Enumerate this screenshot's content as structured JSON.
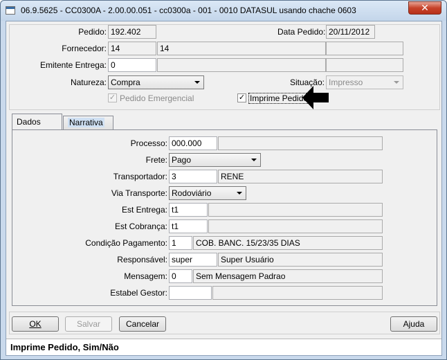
{
  "window": {
    "title": "06.9.5625 - CC0300A - 2.00.00.051 - cc0300a - 001 - 0010 DATASUL usando chache 0603",
    "close_symbol": "✕"
  },
  "header": {
    "pedido_label": "Pedido:",
    "pedido_value": "192.402",
    "data_pedido_label": "Data Pedido:",
    "data_pedido_value": "20/11/2012",
    "fornecedor_label": "Fornecedor:",
    "fornecedor_code": "14",
    "fornecedor_name": "14",
    "emitente_label": "Emitente Entrega:",
    "emitente_value": "0",
    "natureza_label": "Natureza:",
    "natureza_value": "Compra",
    "situacao_label": "Situação:",
    "situacao_value": "Impresso",
    "pedido_emergencial_label": "Pedido Emergencial",
    "imprime_pedido_label": "Imprime Pedido",
    "check_mark": "✓"
  },
  "tabs": [
    {
      "label": "Dados"
    },
    {
      "label": "Narrativa"
    }
  ],
  "dados": {
    "processo_label": "Processo:",
    "processo_value": "000.000",
    "frete_label": "Frete:",
    "frete_value": "Pago",
    "transportador_label": "Transportador:",
    "transportador_code": "3",
    "transportador_name": "RENE",
    "via_label": "Via Transporte:",
    "via_value": "Rodoviário",
    "est_entrega_label": "Est Entrega:",
    "est_entrega_value": "t1",
    "est_cobranca_label": "Est Cobrança:",
    "est_cobranca_value": "t1",
    "cond_label": "Condição Pagamento:",
    "cond_code": "1",
    "cond_desc": "COB. BANC. 15/23/35 DIAS",
    "responsavel_label": "Responsável:",
    "responsavel_code": "super",
    "responsavel_name": "Super Usuário",
    "mensagem_label": "Mensagem:",
    "mensagem_code": "0",
    "mensagem_desc": "Sem Mensagem Padrao",
    "estabel_label": "Estabel Gestor:"
  },
  "buttons": {
    "ok": "OK",
    "salvar": "Salvar",
    "cancelar": "Cancelar",
    "ajuda": "Ajuda"
  },
  "status_text": "Imprime Pedido, Sim/Não"
}
